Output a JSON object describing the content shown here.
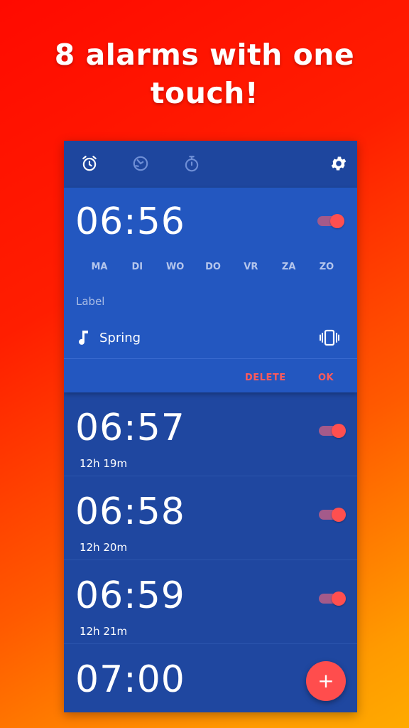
{
  "headline": {
    "line1": "8 alarms with one",
    "line2": "touch!"
  },
  "colors": {
    "accent": "#ff4f4f",
    "panel": "#1f47a0",
    "expanded": "#2357c0"
  },
  "toolbar": {
    "tabs": [
      {
        "icon": "alarm-icon",
        "active": true
      },
      {
        "icon": "world-clock-icon",
        "active": false
      },
      {
        "icon": "stopwatch-icon",
        "active": false
      }
    ],
    "settings_icon": "gear-icon"
  },
  "expanded_alarm": {
    "time": "06:56",
    "enabled": true,
    "days": [
      "MA",
      "DI",
      "WO",
      "DO",
      "VR",
      "ZA",
      "ZO"
    ],
    "label_placeholder": "Label",
    "ringtone": "Spring",
    "delete_label": "DELETE",
    "ok_label": "OK"
  },
  "alarms": [
    {
      "time": "06:57",
      "remaining": "12h 19m",
      "enabled": true
    },
    {
      "time": "06:58",
      "remaining": "12h 20m",
      "enabled": true
    },
    {
      "time": "06:59",
      "remaining": "12h 21m",
      "enabled": true
    },
    {
      "time": "07:00"
    }
  ],
  "fab_label": "+"
}
